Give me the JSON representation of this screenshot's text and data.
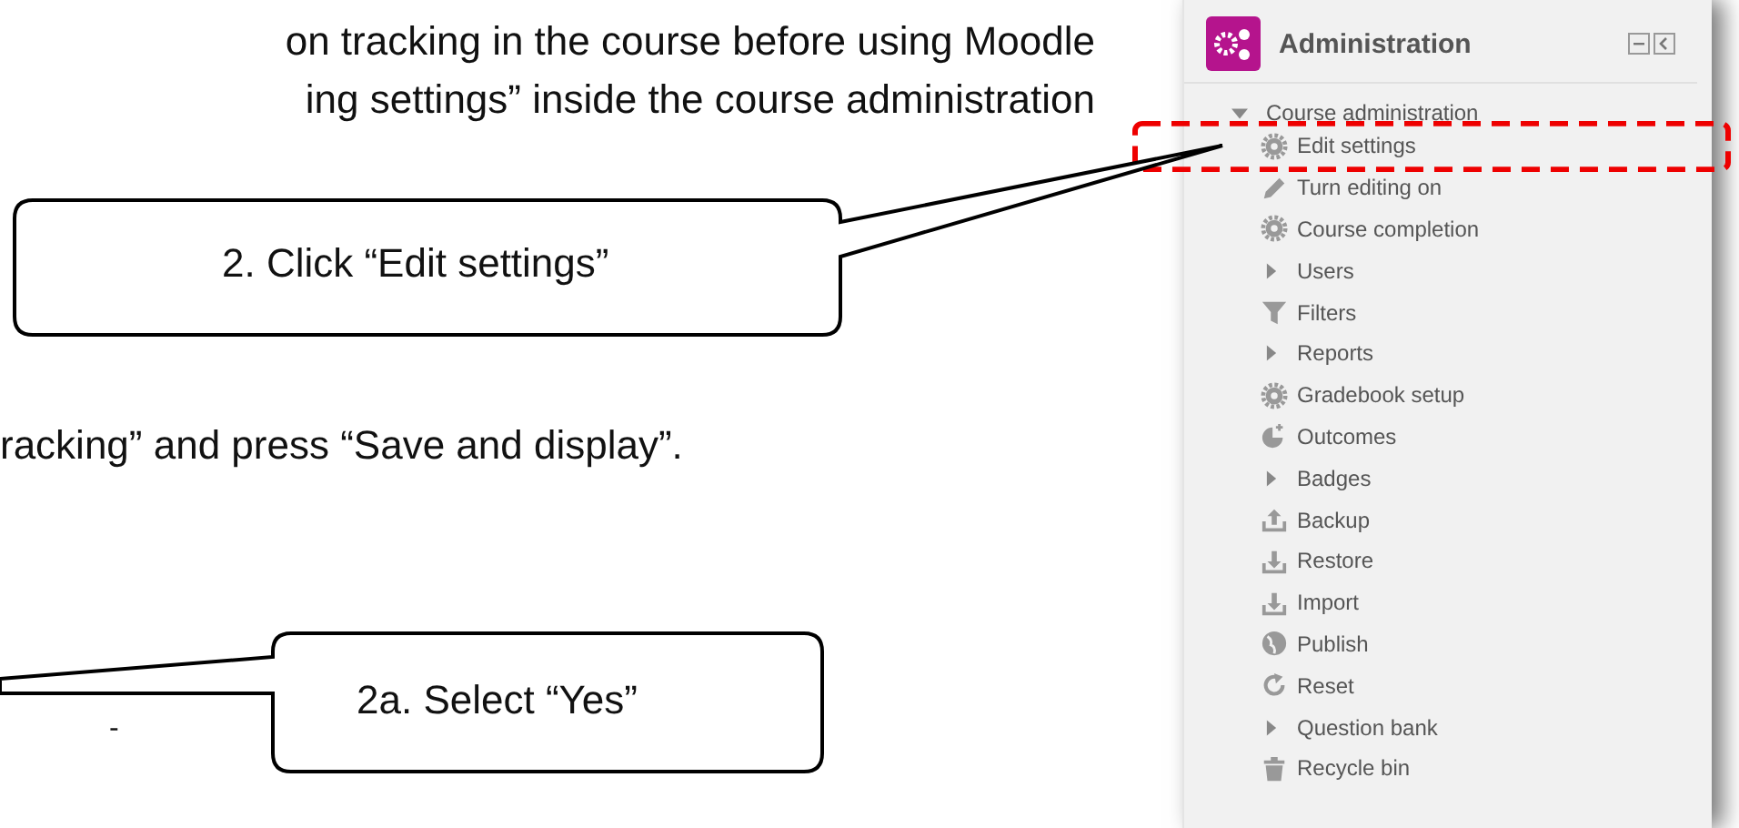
{
  "document": {
    "lines": [
      "on tracking in the course before using Moodle",
      "ing settings” inside the course administration",
      "racking” and press “Save and display”.",
      "-"
    ]
  },
  "callouts": [
    "2. Click “Edit settings”",
    "2a. Select “Yes”"
  ],
  "panel": {
    "title": "Administration",
    "section": {
      "label": "Course administration",
      "expanded": true
    },
    "items": [
      {
        "label": "Edit settings",
        "kind": "link",
        "highlighted": true
      },
      {
        "label": "Turn editing on",
        "kind": "link",
        "highlighted": false
      },
      {
        "label": "Course completion",
        "kind": "link",
        "highlighted": false
      },
      {
        "label": "Users",
        "kind": "branch",
        "highlighted": false
      },
      {
        "label": "Filters",
        "kind": "link",
        "highlighted": false
      },
      {
        "label": "Reports",
        "kind": "branch",
        "highlighted": false
      },
      {
        "label": "Gradebook setup",
        "kind": "link",
        "highlighted": false
      },
      {
        "label": "Outcomes",
        "kind": "link",
        "highlighted": false
      },
      {
        "label": "Badges",
        "kind": "branch",
        "highlighted": false
      },
      {
        "label": "Backup",
        "kind": "link",
        "highlighted": false
      },
      {
        "label": "Restore",
        "kind": "link",
        "highlighted": false
      },
      {
        "label": "Import",
        "kind": "link",
        "highlighted": false
      },
      {
        "label": "Publish",
        "kind": "link",
        "highlighted": false
      },
      {
        "label": "Reset",
        "kind": "link",
        "highlighted": false
      },
      {
        "label": "Question bank",
        "kind": "branch",
        "highlighted": false
      },
      {
        "label": "Recycle bin",
        "kind": "link",
        "highlighted": false
      }
    ]
  }
}
